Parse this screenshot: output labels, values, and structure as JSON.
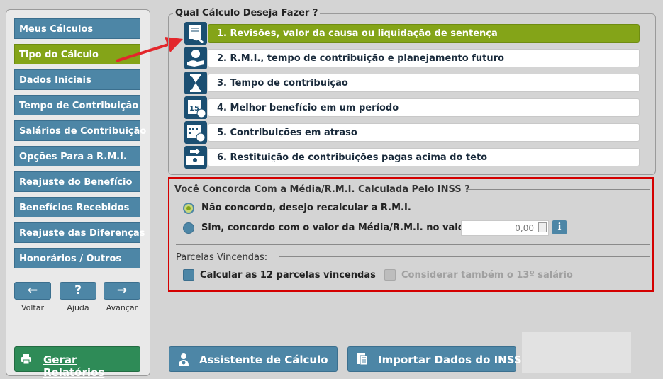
{
  "nav": {
    "items": [
      {
        "label": "Meus Cálculos",
        "active": false
      },
      {
        "label": "Tipo do Cálculo",
        "active": true
      },
      {
        "label": "Dados Iniciais",
        "active": false
      },
      {
        "label": "Tempo de Contribuição",
        "active": false
      },
      {
        "label": "Salários de Contribuição",
        "active": false
      },
      {
        "label": "Opções Para a R.M.I.",
        "active": false
      },
      {
        "label": "Reajuste do Benefício",
        "active": false
      },
      {
        "label": "Benefícios Recebidos",
        "active": false
      },
      {
        "label": "Reajuste das Diferenças",
        "active": false
      },
      {
        "label": "Honorários / Outros",
        "active": false
      }
    ],
    "back": {
      "glyph": "←",
      "label": "Voltar"
    },
    "help": {
      "glyph": "?",
      "label": "Ajuda"
    },
    "next": {
      "glyph": "→",
      "label": "Avançar"
    },
    "generate_label": "Gerar Relatórios"
  },
  "calc_type": {
    "title": "Qual Cálculo Deseja Fazer ?",
    "options": [
      {
        "label": "1. Revisões, valor da causa ou liquidação de sentença",
        "icon": "magnifier-document-icon",
        "active": true
      },
      {
        "label": "2. R.M.I., tempo de contribuição e planejamento futuro",
        "icon": "hand-coin-icon",
        "active": false
      },
      {
        "label": "3. Tempo de contribuição",
        "icon": "hourglass-icon",
        "active": false
      },
      {
        "label": "4. Melhor benefício em um período",
        "icon": "calendar-coin-icon",
        "active": false
      },
      {
        "label": "5. Contribuições em atraso",
        "icon": "calendar-overdue-icon",
        "active": false
      },
      {
        "label": "6. Restituição de contribuições pagas acima do teto",
        "icon": "money-refund-icon",
        "active": false
      }
    ]
  },
  "rmi": {
    "question": "Você Concorda Com a Média/R.M.I. Calculada Pelo INSS ?",
    "disagree_label": "Não concordo, desejo recalcular a R.M.I.",
    "agree_label": "Sim, concordo com o valor da Média/R.M.I. no valor de",
    "value": "0,00",
    "info_glyph": "i",
    "selected": "disagree"
  },
  "parcelas": {
    "title": "Parcelas Vincendas:",
    "calc12_label": "Calcular as 12 parcelas vincendas",
    "salary13_label": "Considerar também o 13º salário"
  },
  "bottom": {
    "assistant_label": "Assistente de Cálculo",
    "import_label": "Importar Dados do INSS"
  },
  "colors": {
    "accent_green": "#84a418",
    "button_blue": "#4d86a6",
    "dark_green": "#2e8b57",
    "highlight_red": "#d40000"
  }
}
